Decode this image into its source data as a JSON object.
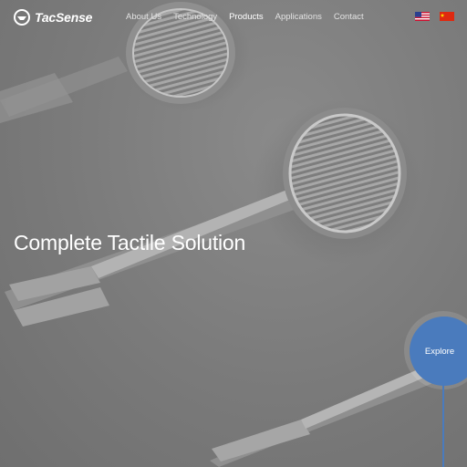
{
  "brand": {
    "name": "TacSense"
  },
  "nav": {
    "items": [
      {
        "label": "About Us",
        "active": false
      },
      {
        "label": "Technology",
        "active": false
      },
      {
        "label": "Products",
        "active": true
      },
      {
        "label": "Applications",
        "active": false
      },
      {
        "label": "Contact",
        "active": false
      }
    ]
  },
  "languages": [
    {
      "icon": "us-flag-icon"
    },
    {
      "icon": "cn-flag-icon"
    }
  ],
  "hero": {
    "title": "Complete Tactile Solution",
    "cta_label": "Explore"
  },
  "colors": {
    "background": "#7c7c7c",
    "accent": "#4a7bbd",
    "text": "#ffffff"
  }
}
